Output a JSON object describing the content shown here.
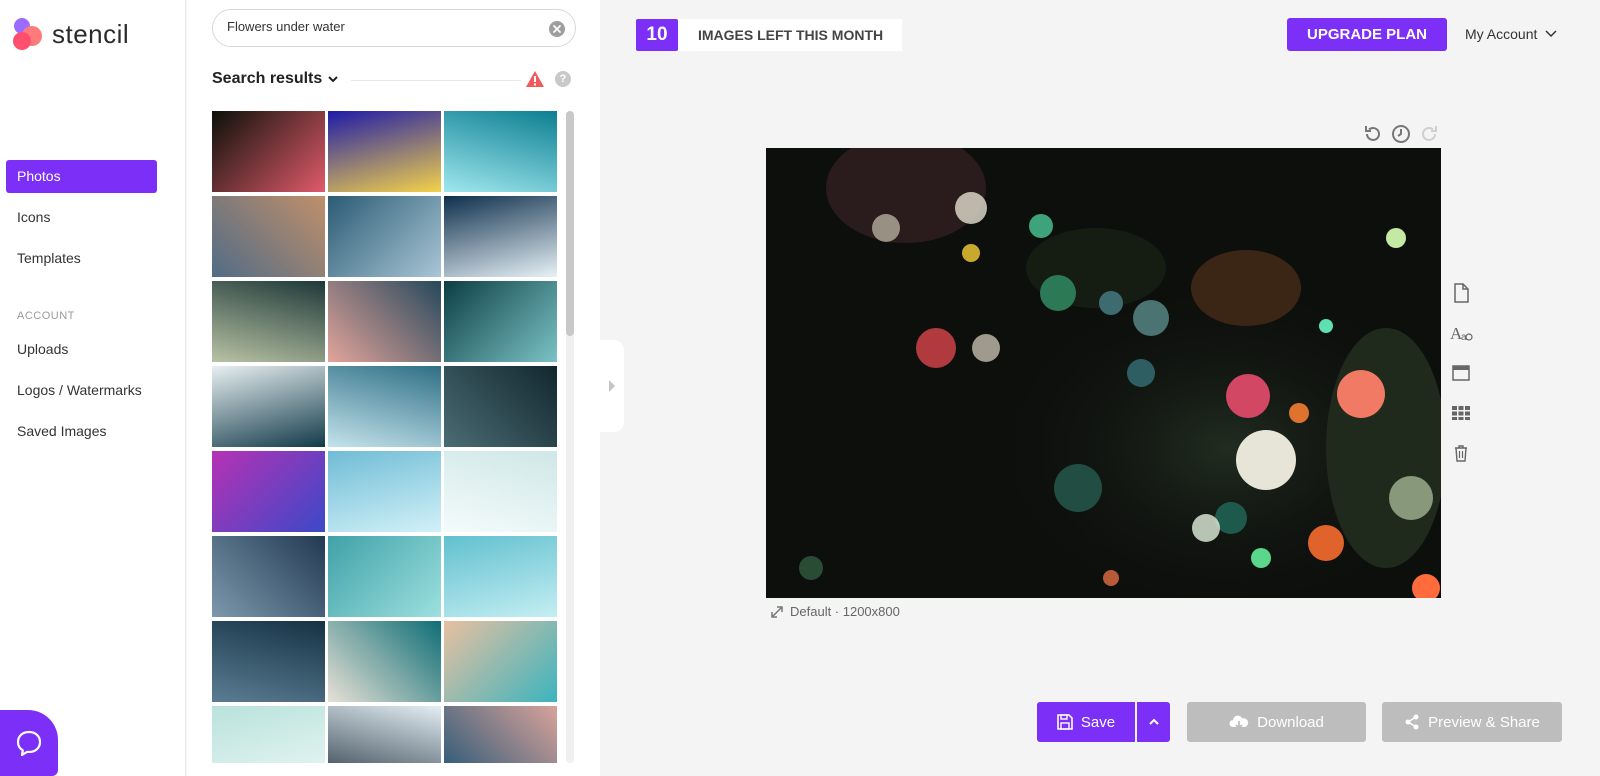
{
  "brand": {
    "name": "stencil"
  },
  "nav": {
    "items": [
      {
        "label": "Photos",
        "active": true
      },
      {
        "label": "Icons",
        "active": false
      },
      {
        "label": "Templates",
        "active": false
      }
    ],
    "section_label": "ACCOUNT",
    "account_items": [
      {
        "label": "Uploads"
      },
      {
        "label": "Logos / Watermarks"
      },
      {
        "label": "Saved Images"
      }
    ]
  },
  "search": {
    "value": "Flowers under water",
    "placeholder": "",
    "results_title": "Search results"
  },
  "results": [
    {
      "name": "sea-anemones-dark",
      "colors": [
        "#0c1109",
        "#e05a6a"
      ]
    },
    {
      "name": "butterflyfish",
      "colors": [
        "#1e1ba8",
        "#f4d24a"
      ]
    },
    {
      "name": "turquoise-bubbles",
      "colors": [
        "#0c7f91",
        "#9fe7ef"
      ]
    },
    {
      "name": "water-splash-sunset",
      "colors": [
        "#c08f6a",
        "#516c86"
      ]
    },
    {
      "name": "ocean-waves",
      "colors": [
        "#2b5b74",
        "#a9c6d6"
      ]
    },
    {
      "name": "curling-wave",
      "colors": [
        "#0e2f4c",
        "#e8f2f7"
      ]
    },
    {
      "name": "water-drop-splash",
      "colors": [
        "#1e3838",
        "#b8c3a4"
      ]
    },
    {
      "name": "sea-sunset",
      "colors": [
        "#26485c",
        "#e3a49a"
      ]
    },
    {
      "name": "aerial-waves",
      "colors": [
        "#0c3e44",
        "#7bc3c5"
      ]
    },
    {
      "name": "white-foam",
      "colors": [
        "#e8f0f2",
        "#123a49"
      ]
    },
    {
      "name": "rushing-water",
      "colors": [
        "#2f6f86",
        "#c4e3ec"
      ]
    },
    {
      "name": "dark-ripples",
      "colors": [
        "#12272e",
        "#4b6c74"
      ]
    },
    {
      "name": "purple-drop",
      "colors": [
        "#b632b4",
        "#3b49c8"
      ]
    },
    {
      "name": "pool-ripples-blue",
      "colors": [
        "#6fbcd6",
        "#d2f1f8"
      ]
    },
    {
      "name": "pool-light-pale",
      "colors": [
        "#cfe7e7",
        "#f4fbfb"
      ]
    },
    {
      "name": "calm-dark-water",
      "colors": [
        "#213a52",
        "#7d98ad"
      ]
    },
    {
      "name": "pool-caustics",
      "colors": [
        "#3fa2a8",
        "#9de0df"
      ]
    },
    {
      "name": "pool-caustics-light",
      "colors": [
        "#61c0cf",
        "#c4eef3"
      ]
    },
    {
      "name": "deep-blue-waves",
      "colors": [
        "#153244",
        "#5b7d93"
      ]
    },
    {
      "name": "beach-aerial",
      "colors": [
        "#0e6e76",
        "#e8e1d6"
      ]
    },
    {
      "name": "beach-sunset",
      "colors": [
        "#e8c0a0",
        "#3cb4be"
      ]
    },
    {
      "name": "shallow-water",
      "colors": [
        "#b9e2dc",
        "#eaf7f4"
      ]
    },
    {
      "name": "hand-in-water",
      "colors": [
        "#e4eef4",
        "#2b3c48"
      ]
    },
    {
      "name": "pink-sky-wave",
      "colors": [
        "#d9a39a",
        "#1f5475"
      ]
    }
  ],
  "topbar": {
    "images_left": "10",
    "images_left_label": "IMAGES LEFT THIS MONTH",
    "upgrade_label": "UPGRADE PLAN",
    "account_label": "My Account"
  },
  "canvas": {
    "preset": "Default",
    "dimensions": "1200x800",
    "caption": "Default · 1200x800"
  },
  "actions": {
    "save_label": "Save",
    "download_label": "Download",
    "share_label": "Preview & Share"
  },
  "colors": {
    "accent": "#7b2ff7",
    "disabled": "#bdbdbd",
    "warning": "#ef5a5a"
  }
}
